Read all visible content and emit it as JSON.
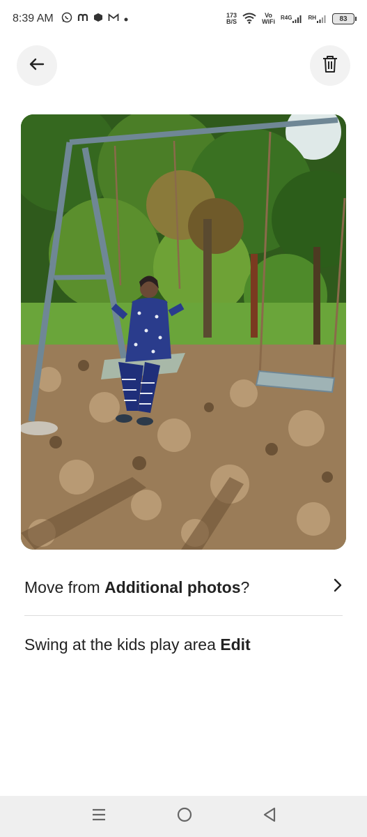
{
  "status_bar": {
    "time": "8:39 AM",
    "net_speed_value": "173",
    "net_speed_unit": "B/S",
    "vowifi_top": "Vo",
    "vowifi_bottom": "WiFi",
    "sim1_label": "R4G",
    "sim2_label": "RH",
    "battery": "83"
  },
  "header": {
    "back_icon": "arrow-left-icon",
    "delete_icon": "trash-icon"
  },
  "photo": {
    "description_icon": "photo-swing"
  },
  "move_row": {
    "prefix": "Move from ",
    "album": "Additional photos",
    "suffix": "?"
  },
  "caption_row": {
    "caption": "Swing at the kids play area",
    "edit_label": "Edit"
  },
  "nav": {
    "menu_icon": "menu-icon",
    "home_icon": "home-circle-icon",
    "back_icon": "back-triangle-icon"
  }
}
